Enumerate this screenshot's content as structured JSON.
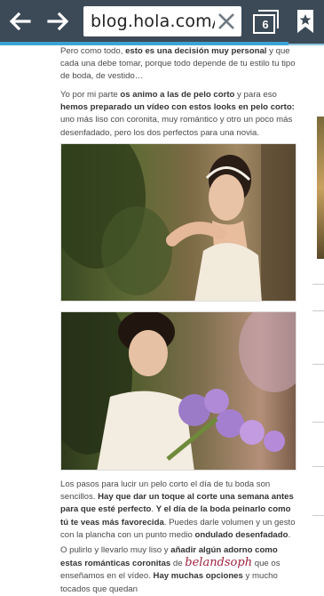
{
  "browser": {
    "url": "blog.hola.com/e",
    "tab_count": "6"
  },
  "article": {
    "p1": {
      "t1": "Pero como todo, ",
      "b1": "esto es una decisión muy personal",
      "t2": " y que cada una debe tomar, porque todo depende de tu estilo tu tipo de boda, de vestido…"
    },
    "p2": {
      "t1": "Yo por mi parte ",
      "b1": "os animo a las de pelo corto",
      "t2": " y para eso ",
      "b2": "hemos preparado un vídeo con estos looks en pelo corto:",
      "t3": " uno más liso con coronita, muy romántico y otro un poco más desenfadado, pero los dos perfectos para una novia."
    },
    "p3": {
      "t1": "Los pasos para lucir un pelo corto el día de tu boda son sencillos. ",
      "b1": "Hay que dar un toque al corte una semana antes para que esté perfecto",
      "t2": ". ",
      "b2": "Y el día de la boda peinarlo como tú te veas más favorecida",
      "t3": ". Puedes darle volumen y un gesto con la plancha con un punto medio ",
      "b3": "ondulado desenfadado",
      "t4": "."
    },
    "p4": {
      "t1": "O pulirlo y llevarlo muy liso y ",
      "b1": "añadir algún adorno como estas románticas coronitas",
      "t2": " de ",
      "signature": "belandsoph",
      "t3": " que os enseñamos en el vídeo. ",
      "b2": "Hay muchas opciones",
      "t4": " y mucho tocados que quedan"
    }
  },
  "colors": {
    "toolbar": "#3c4a57",
    "progress": "#3aa3d6",
    "signature": "#a0233f"
  }
}
